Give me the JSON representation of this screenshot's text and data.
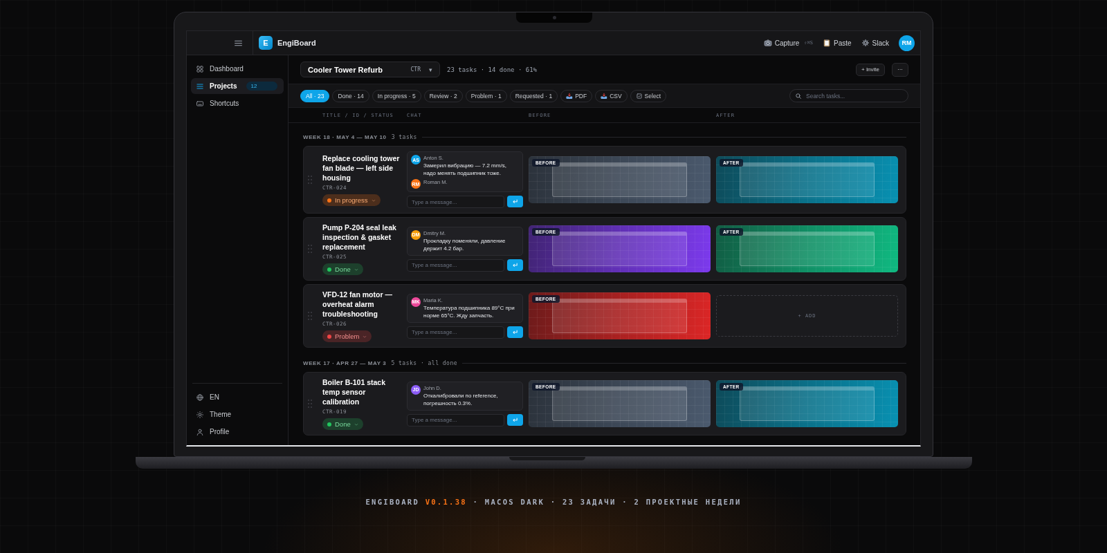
{
  "topbar": {
    "logo_letter": "E",
    "app_name": "EngiBoard",
    "actions": [
      {
        "label": "Capture",
        "shortcut": "⇧⌘S"
      },
      {
        "label": "Paste"
      },
      {
        "label": "Slack"
      }
    ],
    "user_initials": "RM"
  },
  "sidebar": {
    "items": [
      {
        "label": "Dashboard",
        "selected": false
      },
      {
        "label": "Projects",
        "selected": true,
        "badge": "12"
      },
      {
        "label": "Shortcuts",
        "selected": false
      }
    ],
    "footer_items": [
      {
        "label": "EN"
      },
      {
        "label": "Theme"
      },
      {
        "label": "Profile"
      }
    ]
  },
  "project_bar": {
    "project_name": "Cooler Tower Refurb",
    "project_code": "CTR",
    "caret": "▾",
    "stats": "23 tasks · 14 done · 61%",
    "invite_button": "+ Invite",
    "more_button": "···"
  },
  "filters": {
    "chips": [
      {
        "label": "All · 23",
        "selected": true
      },
      {
        "label": "Done · 14",
        "selected": false
      },
      {
        "label": "In progress · 5",
        "selected": false
      },
      {
        "label": "Review · 2",
        "selected": false
      },
      {
        "label": "Problem · 1",
        "selected": false
      },
      {
        "label": "Requested · 1",
        "selected": false
      }
    ],
    "actions": [
      {
        "label": "PDF"
      },
      {
        "label": "CSV"
      },
      {
        "label": "Select"
      }
    ],
    "search": {
      "placeholder": "Search tasks..."
    }
  },
  "columns": [
    "TITLE / ID / STATUS",
    "CHAT",
    "BEFORE",
    "AFTER"
  ],
  "weeks": [
    {
      "title": "WEEK 18 · MAY 4 — MAY 10",
      "summary": "3 tasks",
      "tasks": [
        {
          "title": "Replace cooling tower fan blade — left side housing",
          "id": "CTR-024",
          "status": {
            "label": "In progress",
            "color": "#f97316"
          },
          "messages": [
            {
              "initials": "AS",
              "color": "#0ea5e9",
              "author": "Anton S.",
              "text": "Замерил вибрацию — 7.2 mm/s, надо менять подшипник тоже."
            },
            {
              "initials": "RM",
              "color": "#f97316",
              "author": "Roman M."
            }
          ],
          "input_placeholder": "Type a message...",
          "send_glyph": "↵",
          "before": {
            "kind": "image",
            "label": "BEFORE",
            "color": "#4b5a6e"
          },
          "after": {
            "kind": "image",
            "label": "AFTER",
            "color": "#0891b2"
          }
        },
        {
          "title": "Pump P-204 seal leak inspection & gasket replacement",
          "id": "CTR-025",
          "status": {
            "label": "Done",
            "color": "#22c55e"
          },
          "messages": [
            {
              "initials": "DM",
              "color": "#f59e0b",
              "author": "Dmitry M.",
              "text": "Прокладку поменяли, давление держит 4.2 бар."
            }
          ],
          "input_placeholder": "Type a message...",
          "send_glyph": "↵",
          "before": {
            "kind": "image",
            "label": "BEFORE",
            "color": "#7c3aed"
          },
          "after": {
            "kind": "image",
            "label": "AFTER",
            "color": "#10b981"
          }
        },
        {
          "title": "VFD-12 fan motor — overheat alarm troubleshooting",
          "id": "CTR-026",
          "status": {
            "label": "Problem",
            "color": "#ef4444"
          },
          "messages": [
            {
              "initials": "MK",
              "color": "#ec4899",
              "author": "Maria K.",
              "text": "Температура подшипника 89°C при норме 65°C. Жду запчасть."
            }
          ],
          "input_placeholder": "Type a message...",
          "send_glyph": "↵",
          "before": {
            "kind": "image",
            "label": "BEFORE",
            "color": "#dc2626"
          },
          "after": {
            "kind": "empty",
            "label": "+ ADD"
          }
        }
      ]
    },
    {
      "title": "WEEK 17 · APR 27 — MAY 3",
      "summary": "5 tasks · all done",
      "tasks": [
        {
          "title": "Boiler B-101 stack temp sensor calibration",
          "id": "CTR-019",
          "status": {
            "label": "Done",
            "color": "#22c55e"
          },
          "messages": [
            {
              "initials": "JD",
              "color": "#8b5cf6",
              "author": "John D.",
              "text": "Откалибровали по reference, погрешность 0.3%."
            }
          ],
          "input_placeholder": "Type a message...",
          "send_glyph": "↵",
          "before": {
            "kind": "image",
            "label": "BEFORE",
            "color": "#4b5a6e"
          },
          "after": {
            "kind": "image",
            "label": "AFTER",
            "color": "#0891b2"
          }
        }
      ]
    }
  ],
  "footer_caption": {
    "prefix": "ENGIBOARD",
    "version": "V0.1.38",
    "suffix": "· MACOS DARK · 23 ЗАДАЧИ · 2 ПРОЕКТНЫЕ НЕДЕЛИ"
  }
}
